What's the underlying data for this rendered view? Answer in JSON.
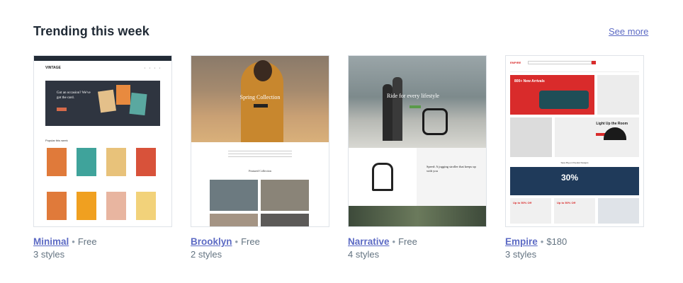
{
  "section": {
    "title": "Trending this week",
    "see_more": "See more"
  },
  "themes": [
    {
      "name": "Minimal",
      "price": "Free",
      "styles": "3 styles",
      "preview": {
        "store_name": "VINTAGE",
        "hero_text": "Got an occasion? We've got the card.",
        "section_label": "Popular this week"
      }
    },
    {
      "name": "Brooklyn",
      "price": "Free",
      "styles": "2 styles",
      "preview": {
        "hero_text": "Spring Collection",
        "section_label": "Featured Collection"
      }
    },
    {
      "name": "Narrative",
      "price": "Free",
      "styles": "4 styles",
      "preview": {
        "hero_text": "Ride for every lifestyle",
        "feature_text": "Speed: A jogging stroller that keeps up with you"
      }
    },
    {
      "name": "Empire",
      "price": "$180",
      "styles": "3 styles",
      "preview": {
        "logo": "EMPIRE",
        "new_arrivals": "800+ New Arrivals",
        "light_text": "Light Up the Room",
        "mid_text": "Save Big on Popular Designs",
        "discount": "30%",
        "promo": "Up to 50% Off"
      }
    }
  ],
  "colors": {
    "link": "#5c6ac4",
    "text": "#212b36",
    "muted": "#637381",
    "empire_red": "#d92b2b"
  }
}
